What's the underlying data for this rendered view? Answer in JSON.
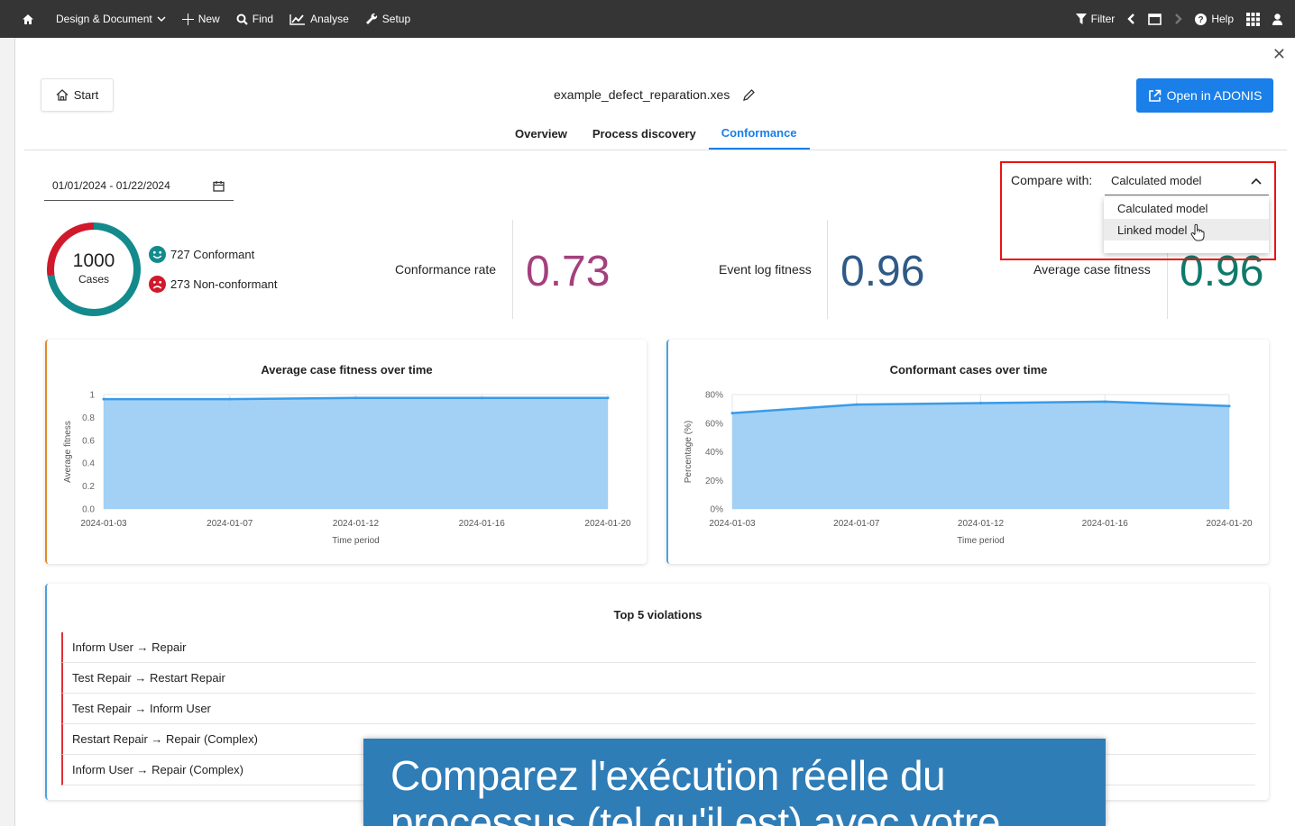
{
  "toolbar": {
    "home": "",
    "design": "Design & Document",
    "new": "New",
    "find": "Find",
    "analyse": "Analyse",
    "setup": "Setup",
    "filter": "Filter",
    "help": "Help"
  },
  "header": {
    "start_label": "Start",
    "filename": "example_defect_reparation.xes",
    "open_label": "Open in ADONIS"
  },
  "tabs": [
    {
      "label": "Overview"
    },
    {
      "label": "Process discovery"
    },
    {
      "label": "Conformance"
    }
  ],
  "date_range": "01/01/2024 - 01/22/2024",
  "cases": {
    "total": "1000",
    "total_label": "Cases",
    "conformant": 727,
    "conformant_label": "727 Conformant",
    "non_conformant": 273,
    "non_conformant_label": "273 Non-conformant"
  },
  "metrics": {
    "conformance_rate_label": "Conformance rate",
    "conformance_rate": "0.73",
    "event_log_fitness_label": "Event log fitness",
    "event_log_fitness": "0.96",
    "average_case_fitness_label": "Average case fitness",
    "average_case_fitness": "0.96"
  },
  "compare": {
    "label": "Compare with:",
    "selected": "Calculated model",
    "options": [
      "Calculated model",
      "Linked model"
    ]
  },
  "colors": {
    "accent": "#1a7fe8",
    "conformance_rate": "#a4407e",
    "event_log_fitness": "#2f5a88",
    "average_case_fitness": "#0f7a6c",
    "donut_conformant": "#138a8c",
    "donut_non_conformant": "#d0192b",
    "chart_fill": "#9ecff4",
    "chart_line": "#3a9be8"
  },
  "chart_data": [
    {
      "type": "area",
      "title": "Average case fitness over time",
      "xlabel": "Time period",
      "ylabel": "Average fitness",
      "x": [
        "2024-01-03",
        "2024-01-07",
        "2024-01-12",
        "2024-01-16",
        "2024-01-20"
      ],
      "values": [
        0.96,
        0.96,
        0.97,
        0.97,
        0.97
      ],
      "yticks": [
        "0.0",
        "0.2",
        "0.4",
        "0.6",
        "0.8",
        "1"
      ],
      "ylim": [
        0,
        1
      ],
      "grid": true,
      "legend": "none"
    },
    {
      "type": "area",
      "title": "Conformant cases over time",
      "xlabel": "Time period",
      "ylabel": "Percentage (%)",
      "x": [
        "2024-01-03",
        "2024-01-07",
        "2024-01-12",
        "2024-01-16",
        "2024-01-20"
      ],
      "values": [
        67,
        73,
        74,
        75,
        72
      ],
      "yticks": [
        "0%",
        "20%",
        "40%",
        "60%",
        "80%"
      ],
      "ylim": [
        0,
        80
      ],
      "grid": true,
      "legend": "none"
    }
  ],
  "violations": {
    "title": "Top 5 violations",
    "items": [
      "Inform User → Repair",
      "Test Repair → Restart Repair",
      "Test Repair → Inform User",
      "Restart Repair → Repair (Complex)",
      "Inform User → Repair (Complex)"
    ]
  },
  "caption": {
    "line1": "Comparez l'exécution réelle du",
    "line2": "processus (tel qu'il est) avec votre"
  }
}
